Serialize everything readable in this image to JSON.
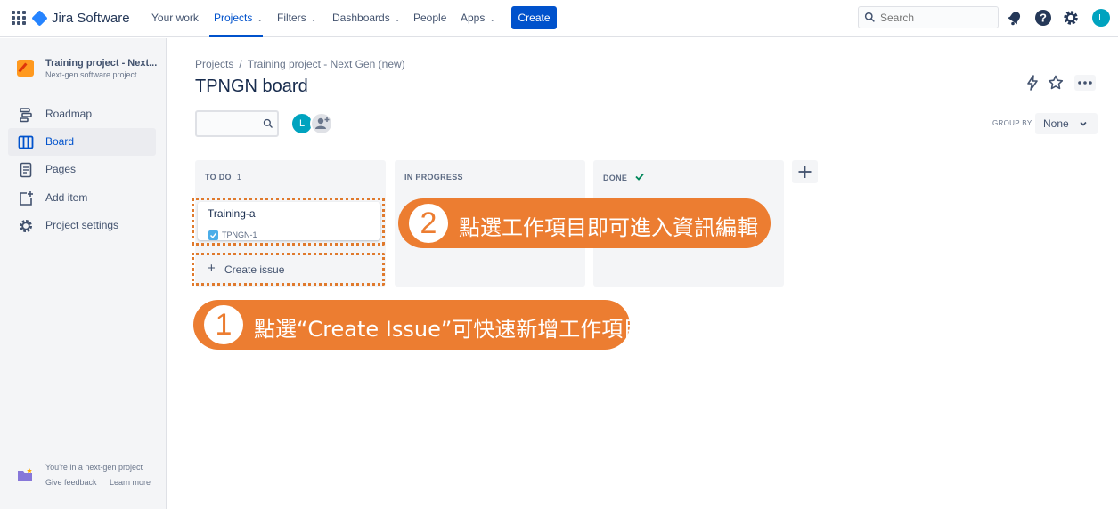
{
  "topnav": {
    "logo_text": "Jira Software",
    "items": [
      {
        "label": "Your work"
      },
      {
        "label": "Projects"
      },
      {
        "label": "Filters"
      },
      {
        "label": "Dashboards"
      },
      {
        "label": "People"
      },
      {
        "label": "Apps"
      }
    ],
    "create_label": "Create",
    "search_placeholder": "Search",
    "user_initial": "L"
  },
  "sidebar": {
    "project_name": "Training project - Next...",
    "project_type": "Next-gen software project",
    "items": [
      {
        "label": "Roadmap"
      },
      {
        "label": "Board"
      },
      {
        "label": "Pages"
      },
      {
        "label": "Add item"
      },
      {
        "label": "Project settings"
      }
    ],
    "footer_text": "You're in a next-gen project",
    "feedback_link": "Give feedback",
    "learn_more_link": "Learn more"
  },
  "main": {
    "breadcrumb": [
      "Projects",
      "Training project - Next Gen (new)"
    ],
    "title": "TPNGN board",
    "assignee_initial": "L",
    "group_by_label": "GROUP BY",
    "group_by_value": "None",
    "columns": [
      {
        "title": "TO DO",
        "count": "1"
      },
      {
        "title": "IN PROGRESS",
        "count": ""
      },
      {
        "title": "DONE",
        "count": ""
      }
    ],
    "card": {
      "title": "Training-a",
      "key": "TPNGN-1"
    },
    "create_issue_label": "Create issue"
  },
  "callouts": [
    {
      "number": "2",
      "text": "點選工作項目即可進入資訊編輯"
    },
    {
      "number": "1",
      "text": "點選“Create Issue”可快速新增工作項目"
    }
  ],
  "colors": {
    "brand_blue": "#0052cc",
    "callout_orange": "#ec7d31",
    "sidebar_bg": "#f4f5f7"
  }
}
